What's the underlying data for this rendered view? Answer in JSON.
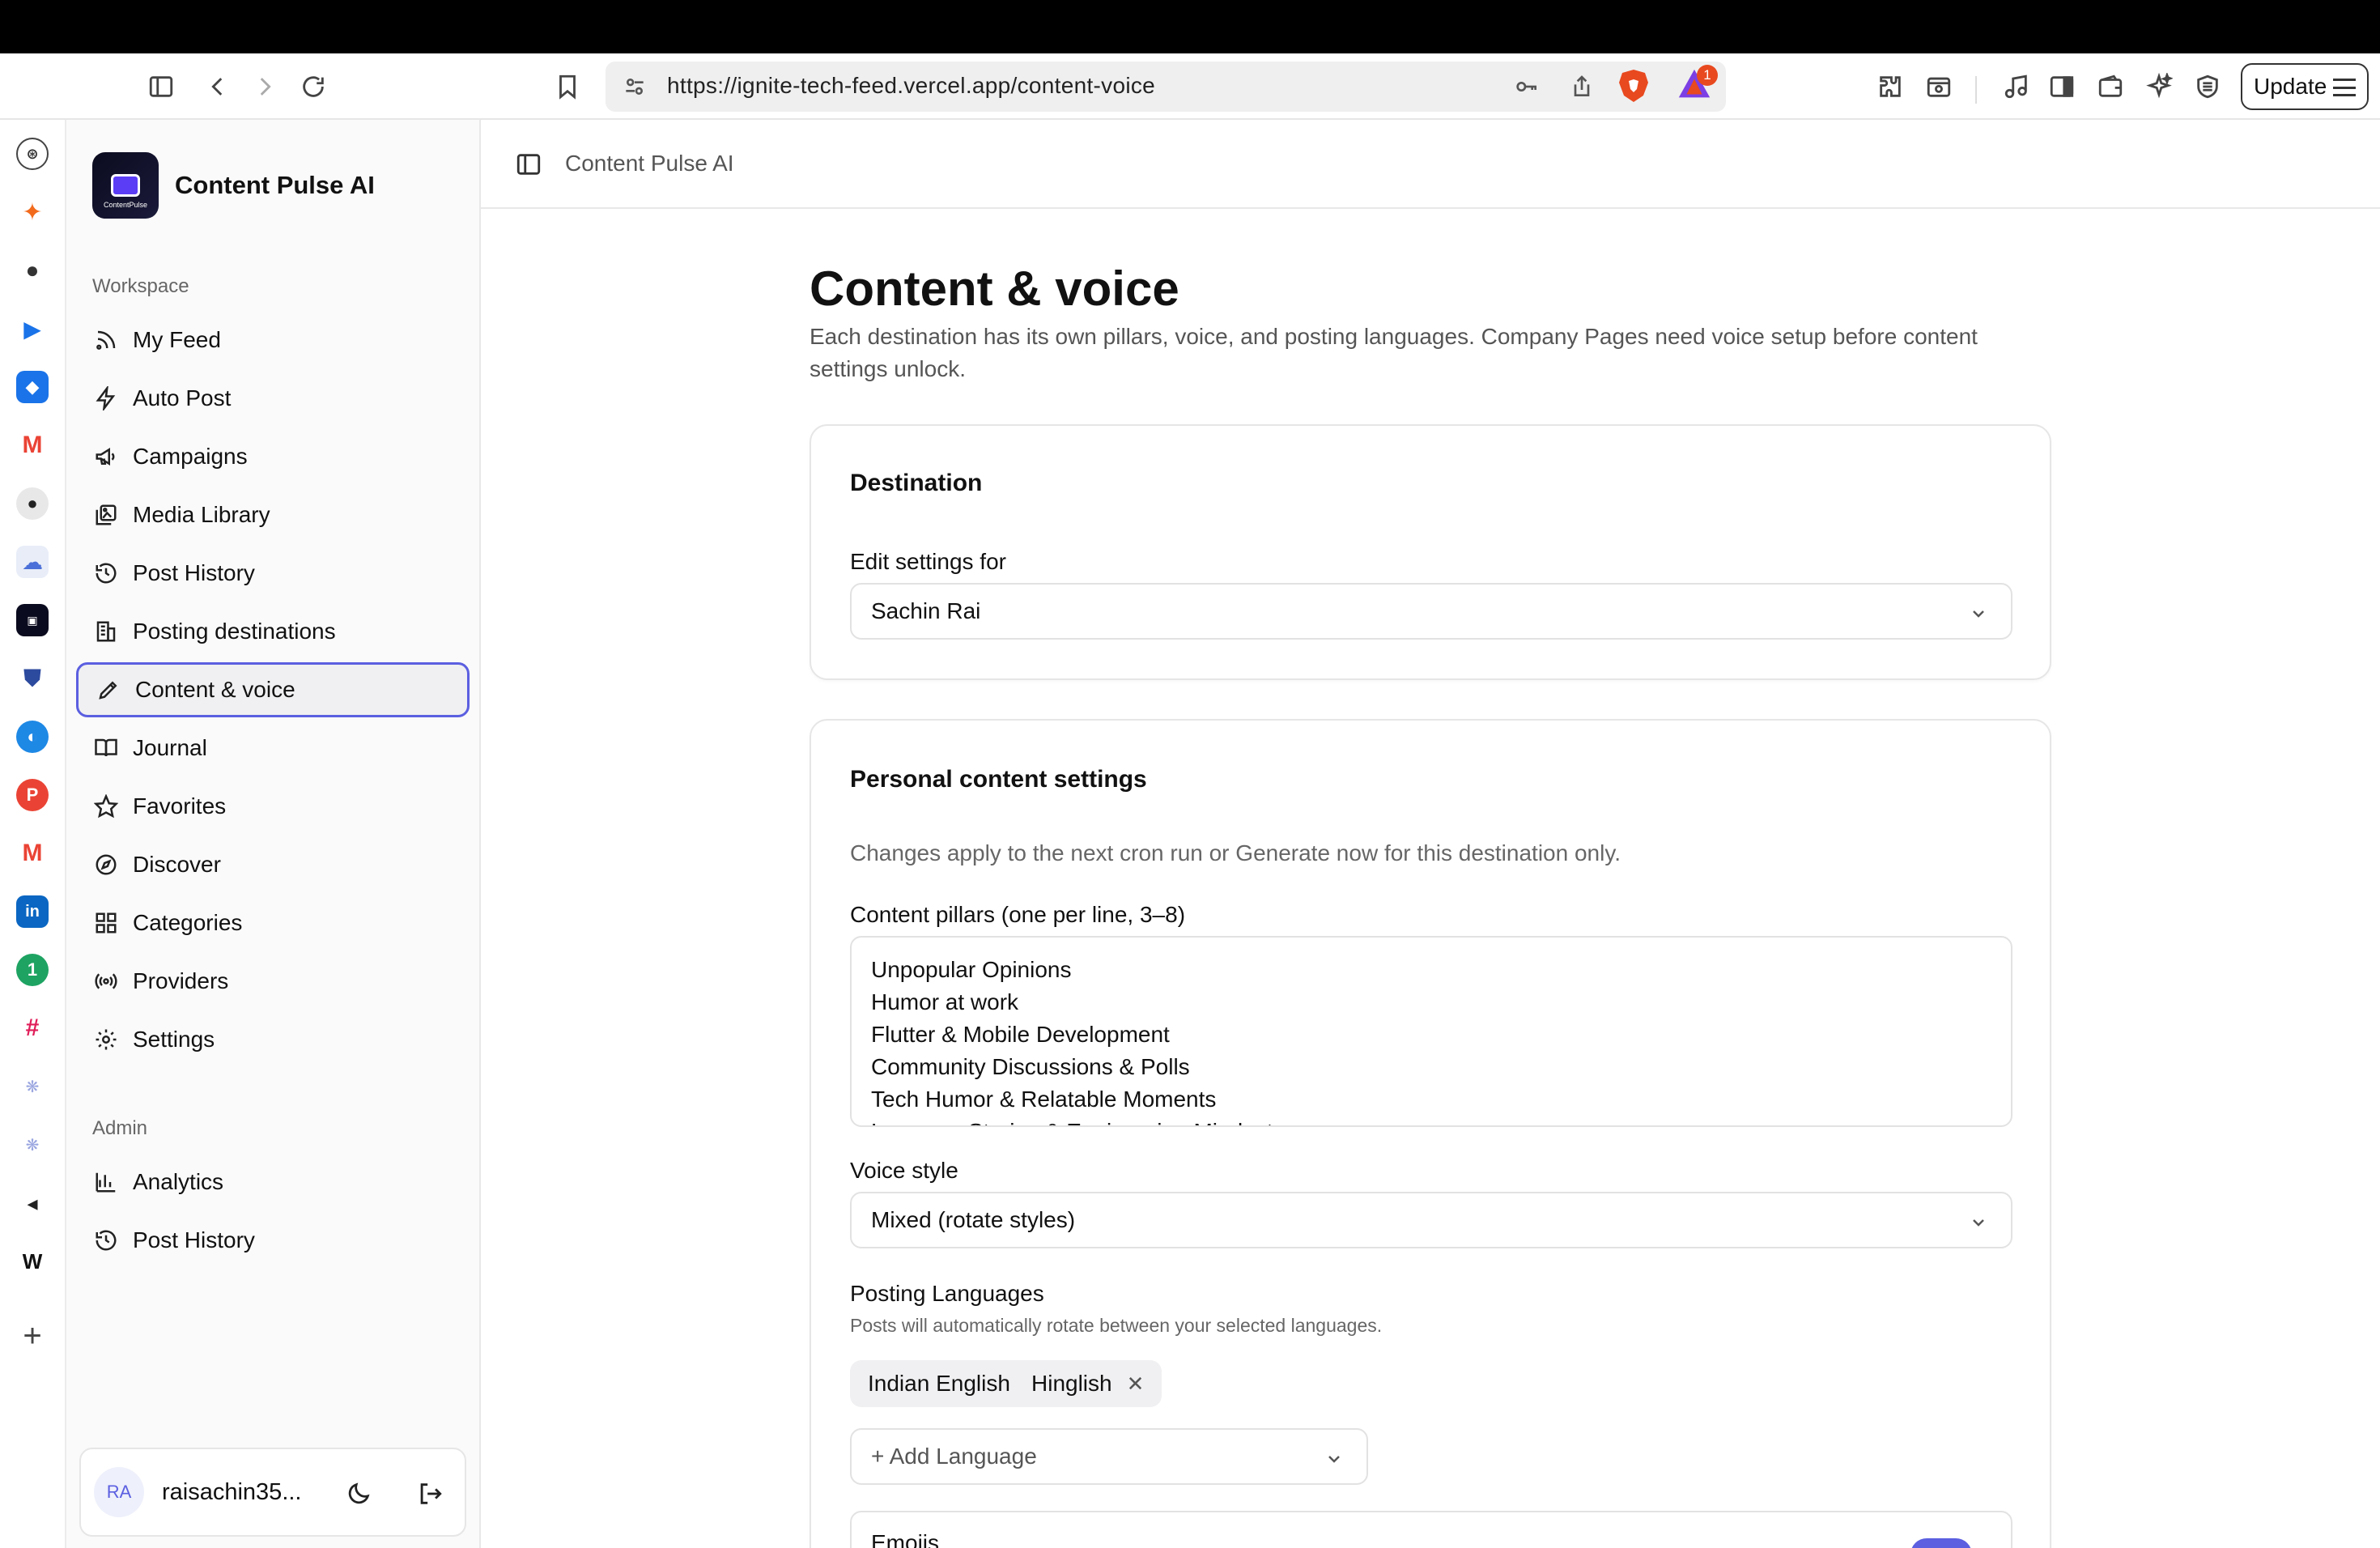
{
  "browser": {
    "url": "https://ignite-tech-feed.vercel.app/content-voice",
    "update_label": "Update",
    "rewards_badge": "1"
  },
  "sidebar": {
    "brand": "Content Pulse AI",
    "logo_text": "ContentPulse",
    "workspace_label": "Workspace",
    "items": [
      {
        "label": "My Feed",
        "icon": "rss-icon"
      },
      {
        "label": "Auto Post",
        "icon": "zap-icon"
      },
      {
        "label": "Campaigns",
        "icon": "megaphone-icon"
      },
      {
        "label": "Media Library",
        "icon": "images-icon"
      },
      {
        "label": "Post History",
        "icon": "history-icon"
      },
      {
        "label": "Posting destinations",
        "icon": "building-icon"
      },
      {
        "label": "Content & voice",
        "icon": "pen-icon",
        "active": true
      },
      {
        "label": "Journal",
        "icon": "book-icon"
      },
      {
        "label": "Favorites",
        "icon": "star-icon"
      },
      {
        "label": "Discover",
        "icon": "compass-icon"
      },
      {
        "label": "Categories",
        "icon": "grid-icon"
      },
      {
        "label": "Providers",
        "icon": "radio-icon"
      },
      {
        "label": "Settings",
        "icon": "gear-icon"
      }
    ],
    "admin_label": "Admin",
    "admin_items": [
      {
        "label": "Analytics",
        "icon": "bar-chart-icon"
      },
      {
        "label": "Post History",
        "icon": "history-icon"
      }
    ],
    "user": {
      "initials": "RA",
      "name": "raisachin35..."
    }
  },
  "header": {
    "title": "Content Pulse AI"
  },
  "page": {
    "title": "Content & voice",
    "description": "Each destination has its own pillars, voice, and posting languages. Company Pages need voice setup before content settings unlock."
  },
  "destination": {
    "title": "Destination",
    "label": "Edit settings for",
    "value": "Sachin Rai"
  },
  "personal": {
    "title": "Personal content settings",
    "hint": "Changes apply to the next cron run or Generate now for this destination only.",
    "pillars_label": "Content pillars (one per line, 3–8)",
    "pillars": [
      "Unpopular Opinions",
      "Humor at work",
      "Flutter & Mobile Development",
      "Community Discussions & Polls",
      "Tech Humor & Relatable Moments",
      "Lessons, Stories & Engineering Mindset"
    ],
    "voice_label": "Voice style",
    "voice_value": "Mixed (rotate styles)",
    "languages_label": "Posting Languages",
    "languages_hint": "Posts will automatically rotate between your selected languages.",
    "languages": [
      "Indian English",
      "Hinglish"
    ],
    "add_language": "+ Add Language",
    "emojis_label": "Emojis",
    "emojis_enabled": true
  },
  "colors": {
    "accent": "#5b5fe0",
    "brave": "#e8491f"
  }
}
